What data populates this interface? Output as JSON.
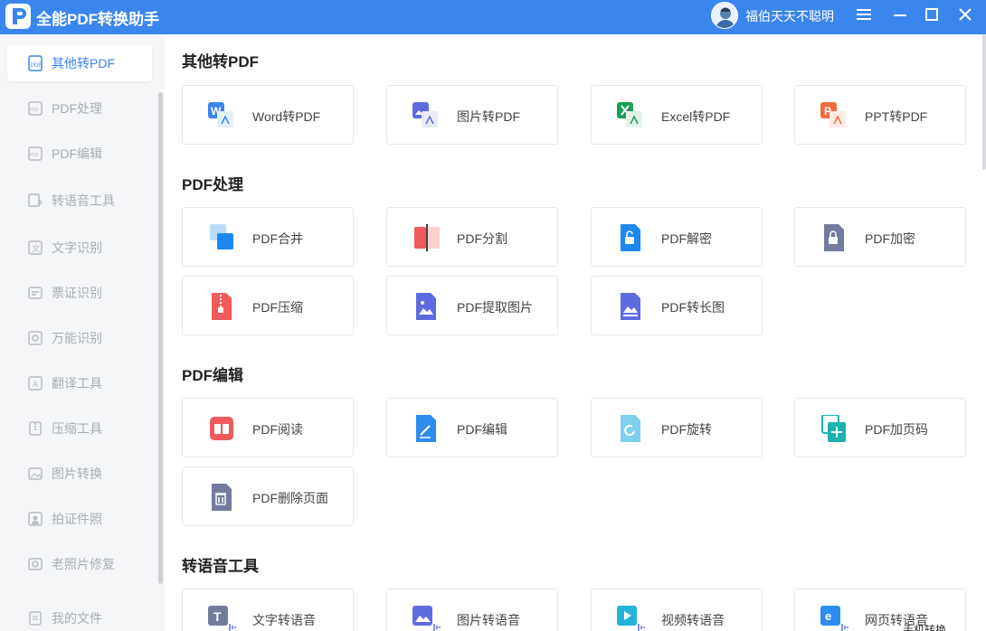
{
  "window": {
    "title": "全能PDF转换助手",
    "user_name": "福伯天天不聪明",
    "accent": "#3b86ee"
  },
  "sidebar": {
    "items": [
      {
        "label": "其他转PDF",
        "icon": "pdf-file-icon",
        "active": true
      },
      {
        "label": "PDF处理",
        "icon": "pdf-process-icon"
      },
      {
        "label": "PDF编辑",
        "icon": "pdf-edit-icon"
      },
      {
        "label": "转语音工具",
        "icon": "voice-icon"
      },
      {
        "label": "文字识别",
        "icon": "text-ocr-icon"
      },
      {
        "label": "票证识别",
        "icon": "ticket-ocr-icon"
      },
      {
        "label": "万能识别",
        "icon": "universal-ocr-icon"
      },
      {
        "label": "翻译工具",
        "icon": "translate-icon"
      },
      {
        "label": "压缩工具",
        "icon": "compress-icon"
      },
      {
        "label": "图片转换",
        "icon": "image-convert-icon"
      },
      {
        "label": "拍证件照",
        "icon": "id-photo-icon"
      },
      {
        "label": "老照片修复",
        "icon": "photo-repair-icon"
      },
      {
        "label": "我的文件",
        "icon": "my-files-icon"
      }
    ]
  },
  "sections": [
    {
      "title": "其他转PDF",
      "cards": [
        "Word转PDF",
        "图片转PDF",
        "Excel转PDF",
        "PPT转PDF"
      ]
    },
    {
      "title": "PDF处理",
      "cards": [
        "PDF合并",
        "PDF分割",
        "PDF解密",
        "PDF加密",
        "PDF压缩",
        "PDF提取图片",
        "PDF转长图"
      ]
    },
    {
      "title": "PDF编辑",
      "cards": [
        "PDF阅读",
        "PDF编辑",
        "PDF旋转",
        "PDF加页码",
        "PDF删除页面"
      ]
    },
    {
      "title": "转语音工具",
      "cards": [
        "文字转语音",
        "图片转语音",
        "视频转语音",
        "网页转语音"
      ]
    }
  ],
  "overlay_text": "手机转换"
}
